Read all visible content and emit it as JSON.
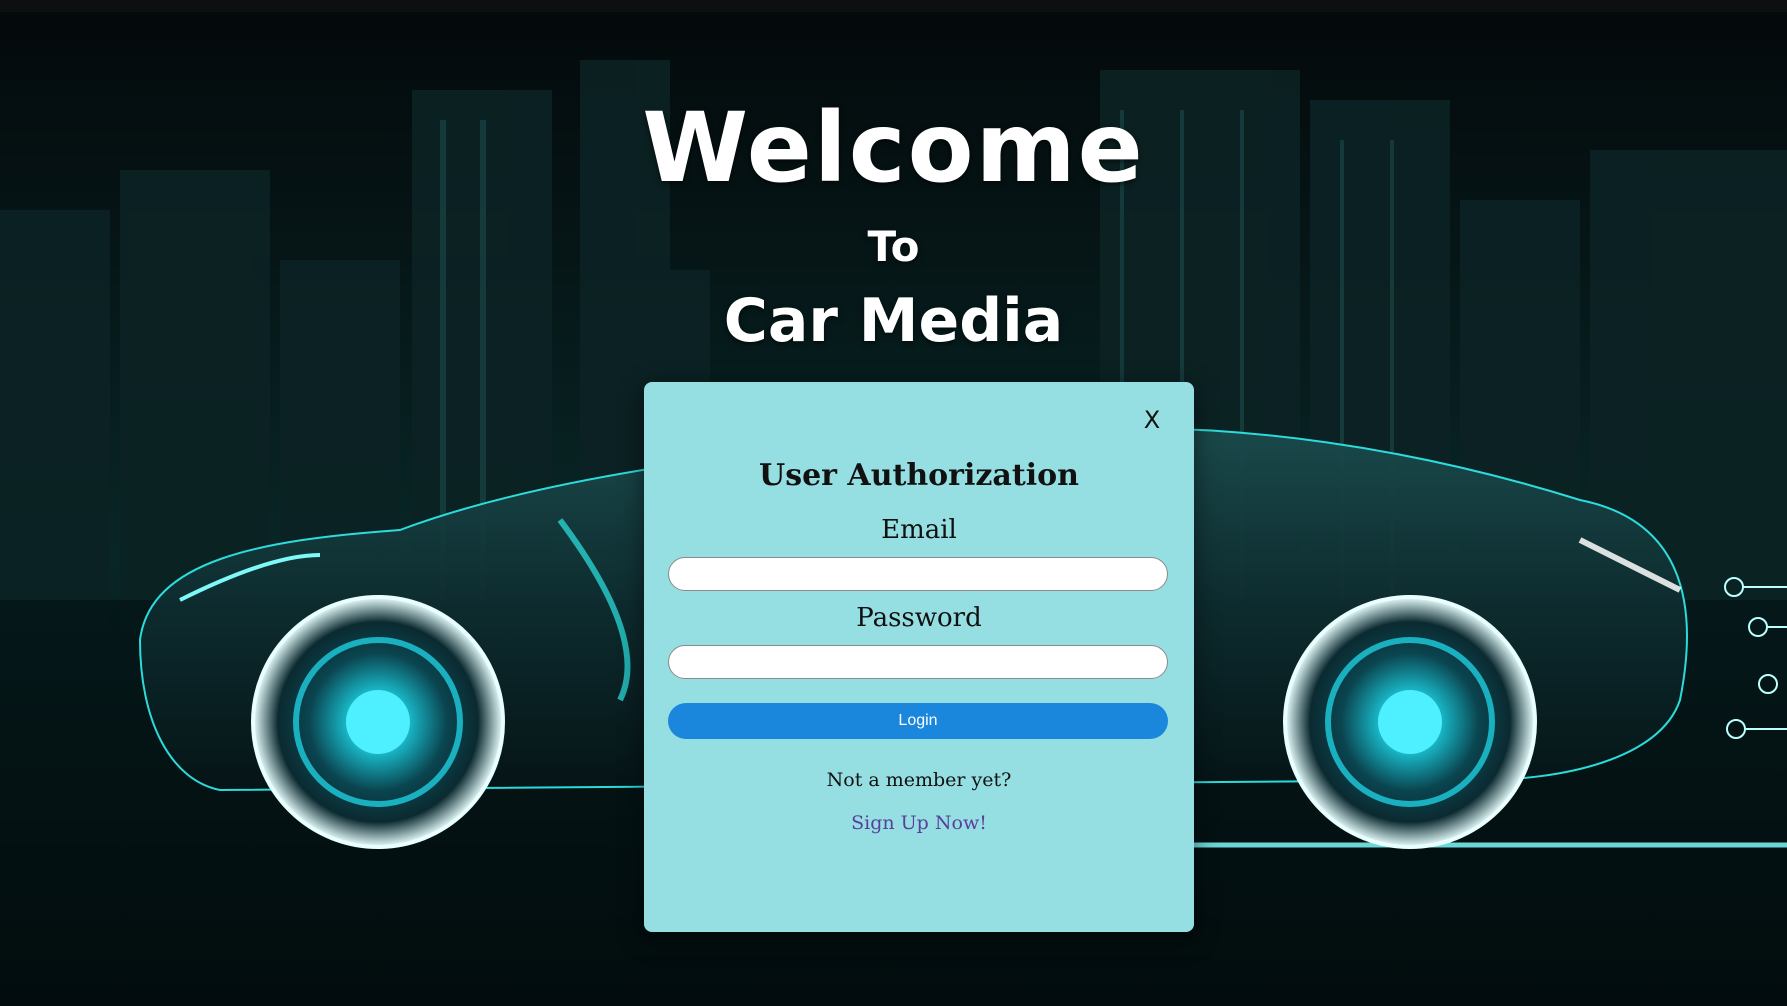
{
  "hero": {
    "welcome": "Welcome",
    "to": "To",
    "brand": "Car Media"
  },
  "modal": {
    "close_label": "X",
    "title": "User Authorization",
    "email_label": "Email",
    "email_value": "",
    "password_label": "Password",
    "password_value": "",
    "login_label": "Login",
    "not_member_text": "Not a member yet?",
    "signup_link": "Sign Up Now!"
  },
  "colors": {
    "modal_bg": "#95dfe3",
    "login_button": "#1a86dc",
    "signup_link": "#5a3e9c",
    "neon_accent": "#2ee6e6"
  },
  "background_image": "neon-car-city-skyline"
}
